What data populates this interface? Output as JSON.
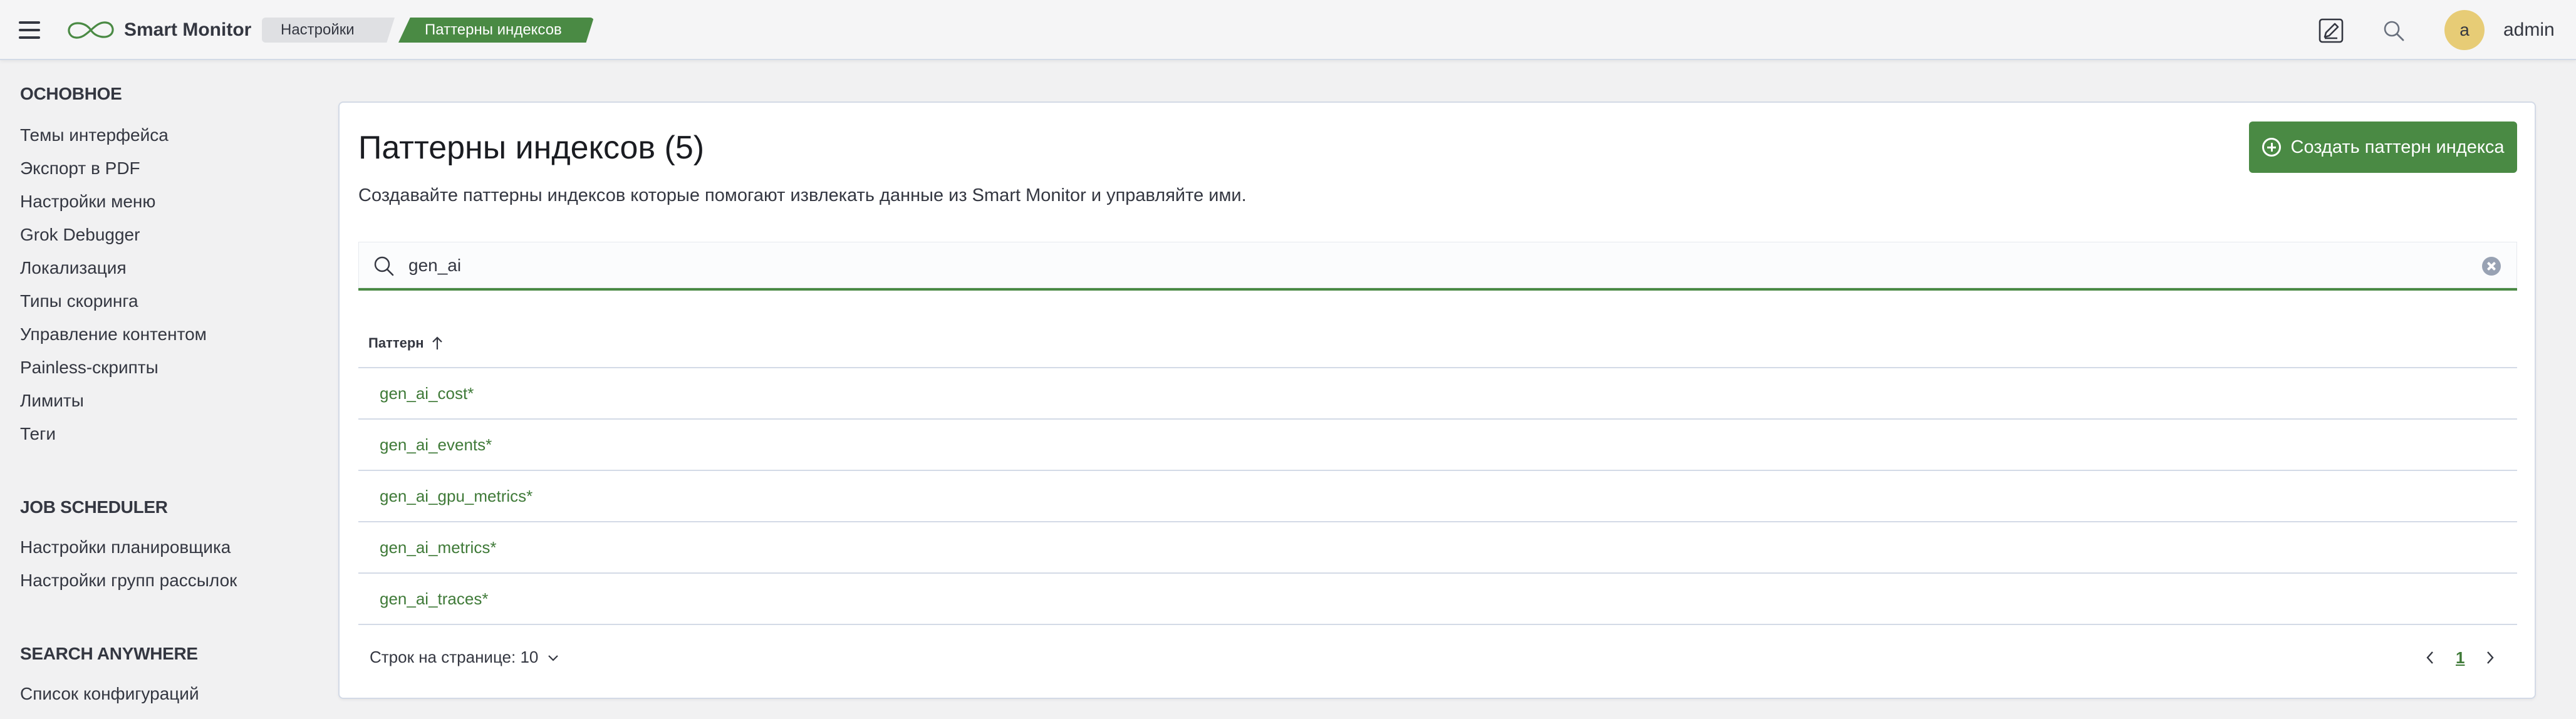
{
  "header": {
    "brand": "Smart Monitor",
    "breadcrumbs": [
      "Настройки",
      "Паттерны индексов"
    ],
    "avatar_initial": "a",
    "username": "admin",
    "icons": [
      "menu-icon",
      "logo-icon",
      "notes-icon",
      "search-icon"
    ]
  },
  "sidebar": {
    "sections": [
      {
        "heading": "ОСНОВНОЕ",
        "items": [
          "Темы интерфейса",
          "Экспорт в PDF",
          "Настройки меню",
          "Grok Debugger",
          "Локализация",
          "Типы скоринга",
          "Управление контентом",
          "Painless-скрипты",
          "Лимиты",
          "Теги"
        ]
      },
      {
        "heading": "JOB SCHEDULER",
        "items": [
          "Настройки планировщика",
          "Настройки групп рассылок"
        ]
      },
      {
        "heading": "SEARCH ANYWHERE",
        "items": [
          "Список конфигураций"
        ]
      }
    ]
  },
  "main": {
    "title": "Паттерны индексов (5)",
    "description": "Создавайте паттерны индексов которые помогают извлекать данные из Smart Monitor и управляйте ими.",
    "create_button": "Создать паттерн индекса",
    "search": {
      "value": "gen_ai"
    },
    "table": {
      "column": "Паттерн",
      "sort": "ascending",
      "rows": [
        "gen_ai_cost*",
        "gen_ai_events*",
        "gen_ai_gpu_metrics*",
        "gen_ai_metrics*",
        "gen_ai_traces*"
      ]
    },
    "rows_per_page": "Строк на странице: 10",
    "current_page": "1"
  },
  "colors": {
    "accent": "#4a8a44",
    "link": "#3f7a38",
    "background": "#f1f1f2",
    "avatar": "#e7cc76"
  }
}
